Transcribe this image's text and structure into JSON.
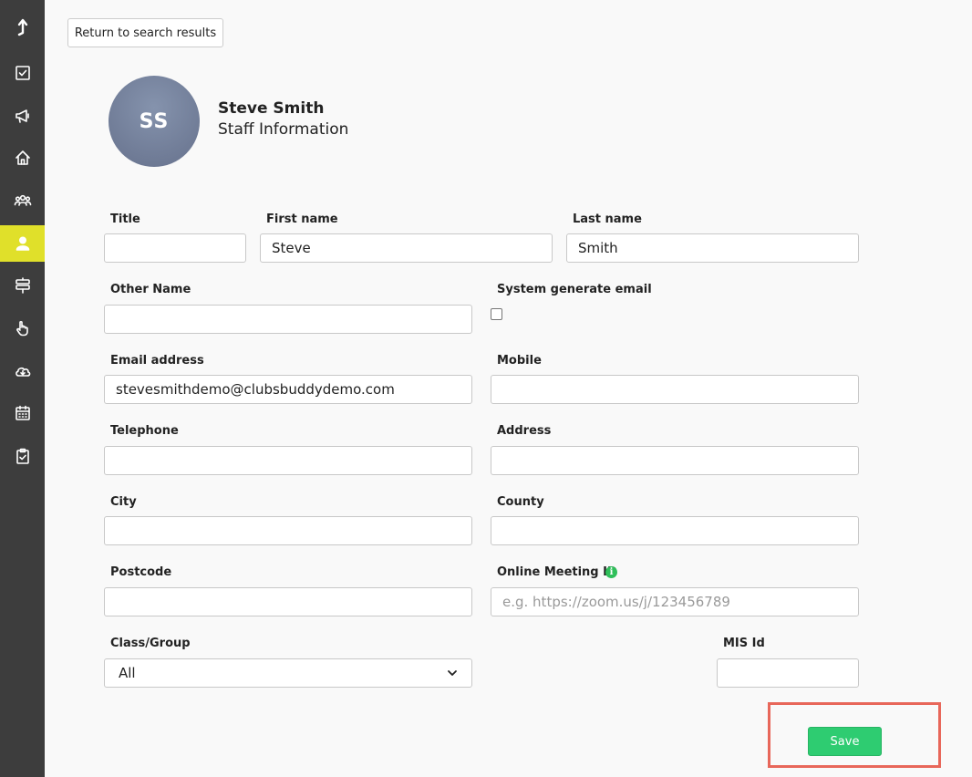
{
  "nav": {
    "back_label": "Return to search results"
  },
  "profile": {
    "initials": "SS",
    "name": "Steve Smith",
    "subtitle": "Staff Information"
  },
  "form": {
    "title": {
      "label": "Title",
      "value": ""
    },
    "first_name": {
      "label": "First name",
      "value": "Steve"
    },
    "last_name": {
      "label": "Last name",
      "value": "Smith"
    },
    "other_name": {
      "label": "Other Name",
      "value": ""
    },
    "system_generate_email": {
      "label": "System generate email",
      "checked": false
    },
    "email": {
      "label": "Email address",
      "value": "stevesmithdemo@clubsbuddydemo.com"
    },
    "mobile": {
      "label": "Mobile",
      "value": ""
    },
    "telephone": {
      "label": "Telephone",
      "value": ""
    },
    "address": {
      "label": "Address",
      "value": ""
    },
    "city": {
      "label": "City",
      "value": ""
    },
    "county": {
      "label": "County",
      "value": ""
    },
    "postcode": {
      "label": "Postcode",
      "value": ""
    },
    "online_meeting_id": {
      "label": "Online Meeting ID",
      "value": "",
      "placeholder": "e.g. https://zoom.us/j/123456789"
    },
    "class_group": {
      "label": "Class/Group",
      "selected": "All"
    },
    "mis_id": {
      "label": "MIS Id",
      "value": ""
    },
    "save_label": "Save"
  },
  "colors": {
    "sidebar_bg": "#3d3d3d",
    "sidebar_active": "#e0e02a",
    "save_green": "#2ecc71",
    "highlight_red": "#e8675a",
    "info_green": "#2fbf5a"
  },
  "sidebar_icons": [
    "upload-arrow-icon",
    "checkbox-icon",
    "megaphone-icon",
    "home-icon",
    "group-icon",
    "user-icon",
    "signpost-icon",
    "hand-pointer-icon",
    "cloud-download-icon",
    "calendar-icon",
    "clipboard-check-icon"
  ]
}
